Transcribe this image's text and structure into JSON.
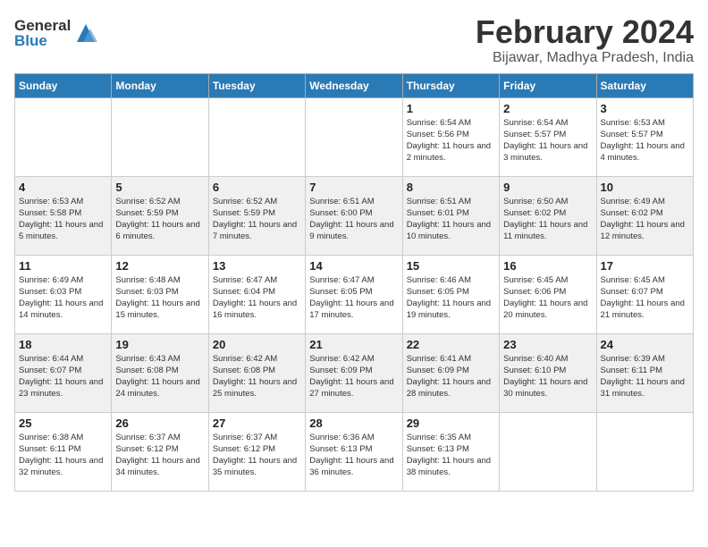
{
  "logo": {
    "general": "General",
    "blue": "Blue"
  },
  "header": {
    "month": "February 2024",
    "location": "Bijawar, Madhya Pradesh, India"
  },
  "weekdays": [
    "Sunday",
    "Monday",
    "Tuesday",
    "Wednesday",
    "Thursday",
    "Friday",
    "Saturday"
  ],
  "weeks": [
    [
      {
        "day": "",
        "info": ""
      },
      {
        "day": "",
        "info": ""
      },
      {
        "day": "",
        "info": ""
      },
      {
        "day": "",
        "info": ""
      },
      {
        "day": "1",
        "sunrise": "6:54 AM",
        "sunset": "5:56 PM",
        "daylight": "11 hours and 2 minutes."
      },
      {
        "day": "2",
        "sunrise": "6:54 AM",
        "sunset": "5:57 PM",
        "daylight": "11 hours and 3 minutes."
      },
      {
        "day": "3",
        "sunrise": "6:53 AM",
        "sunset": "5:57 PM",
        "daylight": "11 hours and 4 minutes."
      }
    ],
    [
      {
        "day": "4",
        "sunrise": "6:53 AM",
        "sunset": "5:58 PM",
        "daylight": "11 hours and 5 minutes."
      },
      {
        "day": "5",
        "sunrise": "6:52 AM",
        "sunset": "5:59 PM",
        "daylight": "11 hours and 6 minutes."
      },
      {
        "day": "6",
        "sunrise": "6:52 AM",
        "sunset": "5:59 PM",
        "daylight": "11 hours and 7 minutes."
      },
      {
        "day": "7",
        "sunrise": "6:51 AM",
        "sunset": "6:00 PM",
        "daylight": "11 hours and 9 minutes."
      },
      {
        "day": "8",
        "sunrise": "6:51 AM",
        "sunset": "6:01 PM",
        "daylight": "11 hours and 10 minutes."
      },
      {
        "day": "9",
        "sunrise": "6:50 AM",
        "sunset": "6:02 PM",
        "daylight": "11 hours and 11 minutes."
      },
      {
        "day": "10",
        "sunrise": "6:49 AM",
        "sunset": "6:02 PM",
        "daylight": "11 hours and 12 minutes."
      }
    ],
    [
      {
        "day": "11",
        "sunrise": "6:49 AM",
        "sunset": "6:03 PM",
        "daylight": "11 hours and 14 minutes."
      },
      {
        "day": "12",
        "sunrise": "6:48 AM",
        "sunset": "6:03 PM",
        "daylight": "11 hours and 15 minutes."
      },
      {
        "day": "13",
        "sunrise": "6:47 AM",
        "sunset": "6:04 PM",
        "daylight": "11 hours and 16 minutes."
      },
      {
        "day": "14",
        "sunrise": "6:47 AM",
        "sunset": "6:05 PM",
        "daylight": "11 hours and 17 minutes."
      },
      {
        "day": "15",
        "sunrise": "6:46 AM",
        "sunset": "6:05 PM",
        "daylight": "11 hours and 19 minutes."
      },
      {
        "day": "16",
        "sunrise": "6:45 AM",
        "sunset": "6:06 PM",
        "daylight": "11 hours and 20 minutes."
      },
      {
        "day": "17",
        "sunrise": "6:45 AM",
        "sunset": "6:07 PM",
        "daylight": "11 hours and 21 minutes."
      }
    ],
    [
      {
        "day": "18",
        "sunrise": "6:44 AM",
        "sunset": "6:07 PM",
        "daylight": "11 hours and 23 minutes."
      },
      {
        "day": "19",
        "sunrise": "6:43 AM",
        "sunset": "6:08 PM",
        "daylight": "11 hours and 24 minutes."
      },
      {
        "day": "20",
        "sunrise": "6:42 AM",
        "sunset": "6:08 PM",
        "daylight": "11 hours and 25 minutes."
      },
      {
        "day": "21",
        "sunrise": "6:42 AM",
        "sunset": "6:09 PM",
        "daylight": "11 hours and 27 minutes."
      },
      {
        "day": "22",
        "sunrise": "6:41 AM",
        "sunset": "6:09 PM",
        "daylight": "11 hours and 28 minutes."
      },
      {
        "day": "23",
        "sunrise": "6:40 AM",
        "sunset": "6:10 PM",
        "daylight": "11 hours and 30 minutes."
      },
      {
        "day": "24",
        "sunrise": "6:39 AM",
        "sunset": "6:11 PM",
        "daylight": "11 hours and 31 minutes."
      }
    ],
    [
      {
        "day": "25",
        "sunrise": "6:38 AM",
        "sunset": "6:11 PM",
        "daylight": "11 hours and 32 minutes."
      },
      {
        "day": "26",
        "sunrise": "6:37 AM",
        "sunset": "6:12 PM",
        "daylight": "11 hours and 34 minutes."
      },
      {
        "day": "27",
        "sunrise": "6:37 AM",
        "sunset": "6:12 PM",
        "daylight": "11 hours and 35 minutes."
      },
      {
        "day": "28",
        "sunrise": "6:36 AM",
        "sunset": "6:13 PM",
        "daylight": "11 hours and 36 minutes."
      },
      {
        "day": "29",
        "sunrise": "6:35 AM",
        "sunset": "6:13 PM",
        "daylight": "11 hours and 38 minutes."
      },
      {
        "day": "",
        "info": ""
      },
      {
        "day": "",
        "info": ""
      }
    ]
  ]
}
